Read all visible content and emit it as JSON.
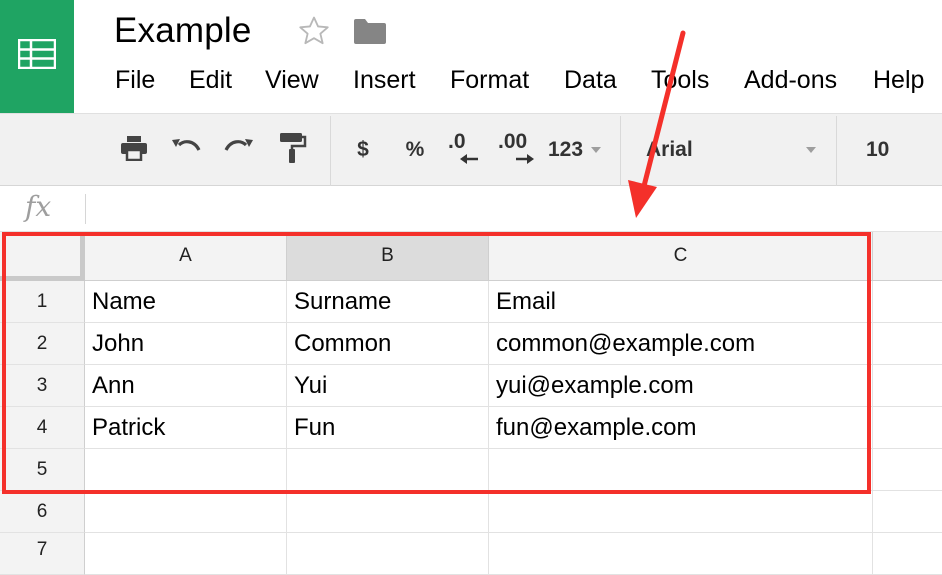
{
  "app": {
    "name": "Google Sheets",
    "accent_color": "#1fa463"
  },
  "document": {
    "title": "Example",
    "star_icon": "star-outline-icon",
    "folder_icon": "folder-icon"
  },
  "menu": [
    "File",
    "Edit",
    "View",
    "Insert",
    "Format",
    "Data",
    "Tools",
    "Add-ons",
    "Help"
  ],
  "toolbar": {
    "print_icon": "print-icon",
    "undo_icon": "undo-icon",
    "redo_icon": "redo-icon",
    "paint_format_icon": "paint-format-icon",
    "currency_label": "$",
    "percent_label": "%",
    "decrease_decimal_label": ".0",
    "increase_decimal_label": ".00",
    "number_format_label": "123",
    "font_family": "Arial",
    "font_size": "10"
  },
  "formula_bar": {
    "icon_label": "fx",
    "value": ""
  },
  "sheet": {
    "columns": [
      "A",
      "B",
      "C"
    ],
    "selected_column": "B",
    "rows": [
      {
        "num": "1",
        "cells": [
          "Name",
          "Surname",
          "Email"
        ]
      },
      {
        "num": "2",
        "cells": [
          "John",
          "Common",
          "common@example.com"
        ]
      },
      {
        "num": "3",
        "cells": [
          "Ann",
          "Yui",
          "yui@example.com"
        ]
      },
      {
        "num": "4",
        "cells": [
          "Patrick",
          "Fun",
          "fun@example.com"
        ]
      },
      {
        "num": "5",
        "cells": [
          "",
          "",
          ""
        ]
      },
      {
        "num": "6",
        "cells": [
          "",
          "",
          ""
        ]
      },
      {
        "num": "7",
        "cells": [
          "",
          "",
          ""
        ]
      }
    ]
  },
  "annotation": {
    "highlight_color": "#f4302a",
    "highlight_target": "A1:C5"
  }
}
